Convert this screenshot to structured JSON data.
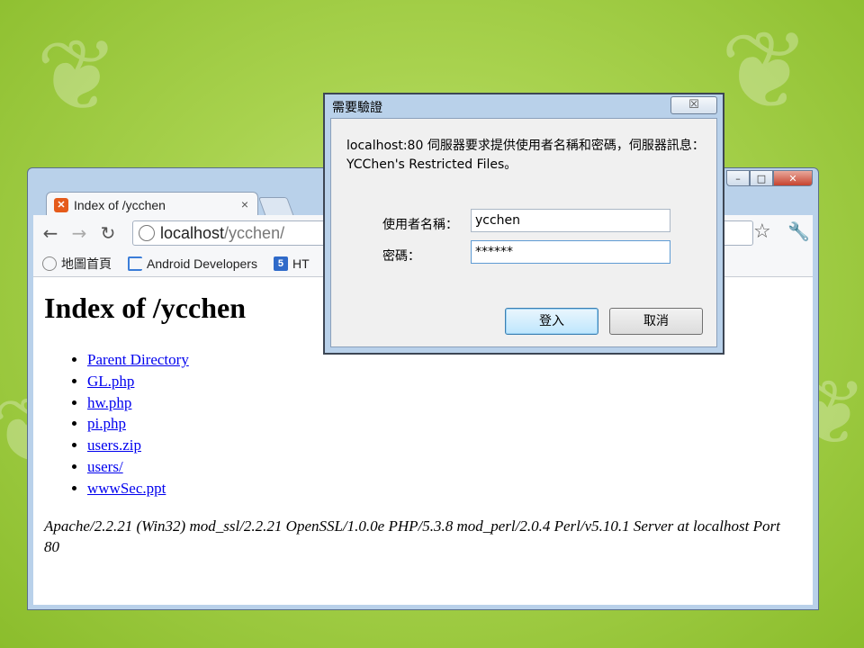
{
  "browser": {
    "tab_title": "Index of /ycchen",
    "tab_close": "×",
    "url_host": "localhost",
    "url_path": "/ycchen/",
    "controls": {
      "minimize": "–",
      "maximize": "□",
      "close": "✕"
    },
    "bookmarks": [
      {
        "label": "地圖首頁",
        "icon": "globe-icon"
      },
      {
        "label": "Android Developers",
        "icon": "android-icon"
      },
      {
        "label": "HT",
        "icon": "html5-icon"
      }
    ]
  },
  "page": {
    "title": "Index of /ycchen",
    "links": [
      "Parent Directory",
      "GL.php",
      "hw.php",
      "pi.php",
      "users.zip",
      "users/",
      "wwwSec.ppt"
    ],
    "server_signature": "Apache/2.2.21 (Win32) mod_ssl/2.2.21 OpenSSL/1.0.0e PHP/5.3.8 mod_perl/2.0.4 Perl/v5.10.1 Server at localhost Port 80"
  },
  "dialog": {
    "title": "需要驗證",
    "close": "☒",
    "message": "localhost:80 伺服器要求提供使用者名稱和密碼，伺服器訊息：YCChen's Restricted Files。",
    "username_label": "使用者名稱：",
    "username_value": "ycchen",
    "password_label": "密碼：",
    "password_value": "******",
    "login_button": "登入",
    "cancel_button": "取消"
  }
}
